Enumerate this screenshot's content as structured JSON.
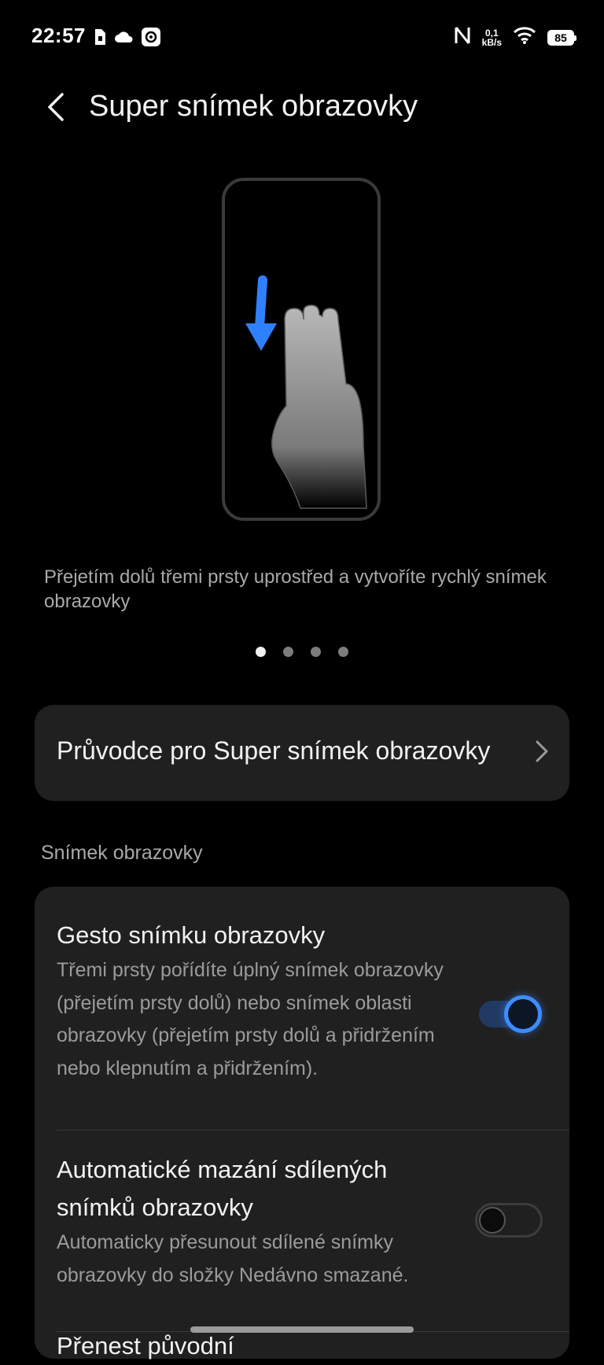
{
  "status_bar": {
    "time": "22:57",
    "net_speed_value": "0,1",
    "net_speed_unit": "kB/s",
    "battery": "85",
    "icons": [
      "sim-icon",
      "cloud-icon",
      "settings-badge-icon",
      "nfc-icon",
      "wifi-icon",
      "battery-icon"
    ]
  },
  "header": {
    "title": "Super snímek obrazovky",
    "back_icon": "back-arrow-icon"
  },
  "illustration": {
    "description_icon": "three-finger-swipe-down-icon",
    "accent_color": "#2f80ff"
  },
  "caption": "Přejetím dolů třemi prsty uprostřed a vytvoříte rychlý snímek obrazovky",
  "pager": {
    "count": 4,
    "active_index": 0
  },
  "guide": {
    "label": "Průvodce pro Super snímek obrazovky"
  },
  "section": {
    "label": "Snímek obrazovky"
  },
  "settings": [
    {
      "title": "Gesto snímku obrazovky",
      "description": "Třemi prsty pořídíte úplný snímek obrazovky (přejetím prsty dolů) nebo snímek oblasti obrazovky (přejetím prsty dolů a přidržením nebo klepnutím a přidržením).",
      "enabled": true
    },
    {
      "title": "Automatické mazání sdílených snímků obrazovky",
      "description": "Automaticky přesunout sdílené snímky obrazovky do složky Nedávno smazané.",
      "enabled": false
    },
    {
      "title": "Přenest původní",
      "description": "",
      "enabled": null
    }
  ],
  "colors": {
    "background": "#000000",
    "card": "#202020",
    "accent": "#3d8cff",
    "secondary_text": "#9b9b9b"
  }
}
